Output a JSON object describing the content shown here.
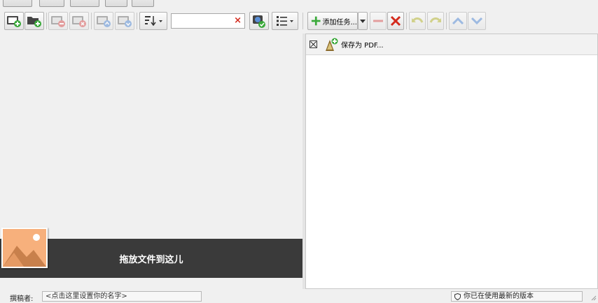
{
  "toolbar": {
    "search_value": "",
    "search_clear_glyph": "×",
    "add_task_label": "添加任务..."
  },
  "tasks": [
    {
      "label": "保存为 PDF..."
    }
  ],
  "drop_zone": {
    "text": "拖放文件到这儿"
  },
  "status": {
    "author_label": "撰稿者:",
    "author_value": "<点击这里设置你的名字>",
    "version_text": "你已在使用最新的版本"
  },
  "colors": {
    "accent_green": "#3aa93a",
    "delete_red": "#d42a1c",
    "nav_blue": "#5a8fd6",
    "drop_bar": "#3a3a3a",
    "drop_image": "#f7b07c"
  },
  "icons": {
    "add_image": "image-add-icon",
    "add_folder": "folder-add-icon",
    "remove_image": "image-remove-icon",
    "delete_image": "image-delete-icon",
    "move_up": "image-up-icon",
    "move_down": "image-down-icon",
    "sort": "sort-icon",
    "convert": "convert-icon",
    "list": "list-view-icon",
    "add": "plus-icon",
    "remove": "minus-icon",
    "delete": "x-icon",
    "undo": "undo-icon",
    "redo": "redo-icon",
    "up": "chevron-up-icon",
    "down": "chevron-down-icon"
  }
}
